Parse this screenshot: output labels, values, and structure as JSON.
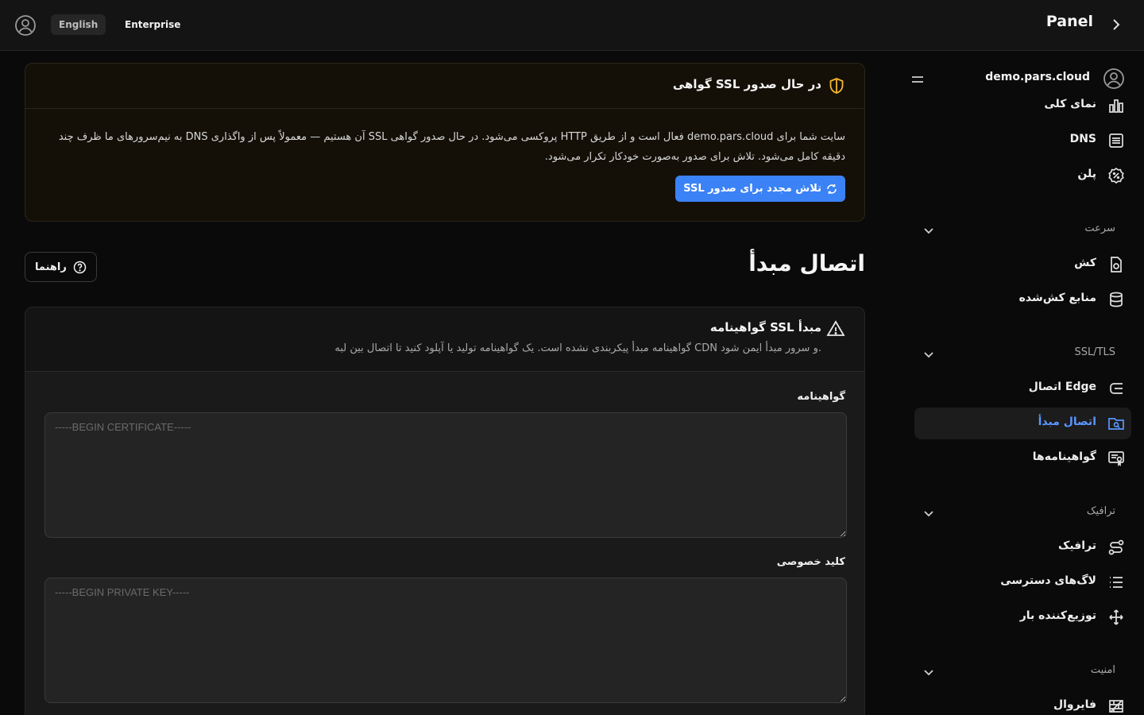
{
  "header": {
    "language": "English",
    "plan": "Enterprise",
    "title": "Panel"
  },
  "sidebar": {
    "domain": "demo.pars.cloud",
    "items_top": [
      {
        "label": "نمای کلی",
        "icon": "chart-icon"
      },
      {
        "label": "DNS",
        "icon": "list-icon"
      },
      {
        "label": "پلن",
        "icon": "badge-icon"
      }
    ],
    "groups": [
      {
        "label": "سرعت",
        "items": [
          {
            "label": "کش",
            "icon": "cache-file-icon"
          },
          {
            "label": "منابع کش‌شده",
            "icon": "database-icon"
          }
        ]
      },
      {
        "label": "SSL/TLS",
        "items": [
          {
            "label": "اتصال Edge",
            "icon": "edge-icon"
          },
          {
            "label": "اتصال مبدأ",
            "icon": "folder-icon",
            "active": true
          },
          {
            "label": "گواهینامه‌ها",
            "icon": "certificate-icon"
          }
        ]
      },
      {
        "label": "ترافیک",
        "items": [
          {
            "label": "ترافیک",
            "icon": "route-icon"
          },
          {
            "label": "لاگ‌های دسترسی",
            "icon": "list-lines-icon"
          },
          {
            "label": "توزیع‌کننده بار",
            "icon": "load-balancer-icon"
          }
        ]
      },
      {
        "label": "امنیت",
        "items": [
          {
            "label": "فایروال",
            "icon": "firewall-icon"
          }
        ]
      }
    ]
  },
  "alert": {
    "title": "گواهی SSL در حال صدور",
    "body": "سایت شما برای demo.pars.cloud فعال است و از طریق HTTP پروکسی می‌شود. در حال صدور گواهی SSL آن هستیم — معمولاً پس از واگذاری DNS به نیم‌سرورهای ما ظرف چند دقیقه کامل می‌شود. تلاش برای صدور به‌صورت خودکار تکرار می‌شود.",
    "retry_label": "تلاش مجدد برای صدور SSL"
  },
  "page": {
    "title": "اتصال مبدأ",
    "guide_label": "راهنما"
  },
  "card": {
    "title": "گواهینامه SSL مبدأ",
    "description": "گواهینامه مبدأ پیکربندی نشده است. یک گواهینامه تولید یا آپلود کنید تا اتصال بین لبه CDN و سرور مبدأ ایمن شود.",
    "certificate_label": "گواهینامه",
    "certificate_placeholder": "-----BEGIN CERTIFICATE-----",
    "key_label": "کلید خصوصی",
    "key_placeholder": "-----BEGIN PRIVATE KEY-----"
  },
  "colors": {
    "accent": "#3b82f6",
    "active_text": "#5b95ff",
    "warning": "#f5b731"
  }
}
